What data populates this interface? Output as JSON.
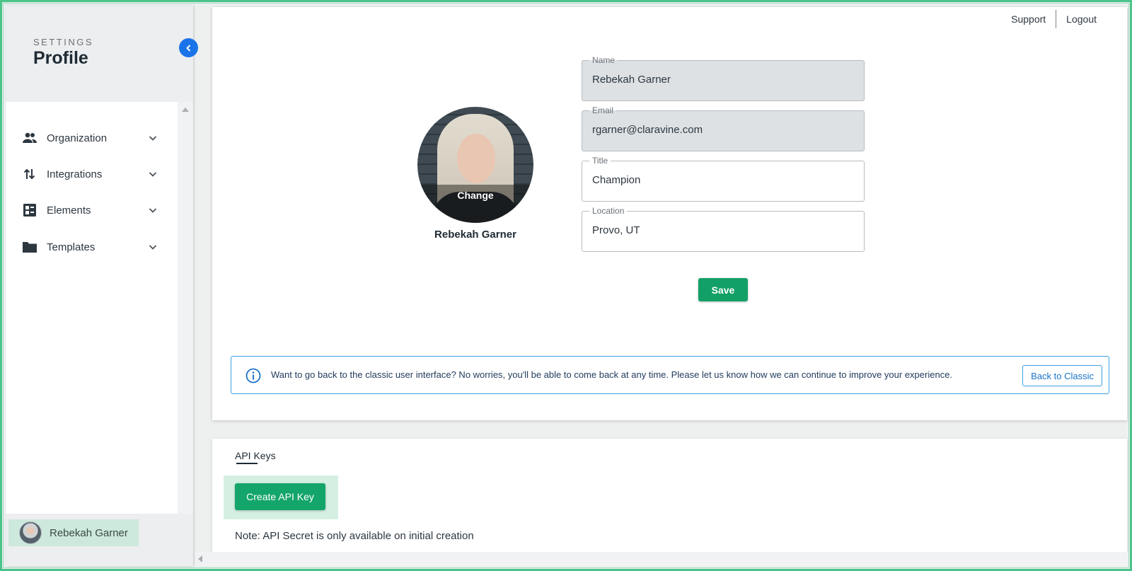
{
  "sidebar": {
    "section_label": "SETTINGS",
    "title": "Profile",
    "items": [
      {
        "label": "Organization",
        "icon": "people-icon"
      },
      {
        "label": "Integrations",
        "icon": "swap-vertical-icon"
      },
      {
        "label": "Elements",
        "icon": "dashboard-icon"
      },
      {
        "label": "Templates",
        "icon": "folder-icon"
      }
    ],
    "user_name": "Rebekah Garner"
  },
  "header": {
    "support_label": "Support",
    "logout_label": "Logout"
  },
  "profile": {
    "change_label": "Change",
    "display_name": "Rebekah Garner",
    "fields": {
      "name": {
        "label": "Name",
        "value": "Rebekah Garner"
      },
      "email": {
        "label": "Email",
        "value": "rgarner@claravine.com"
      },
      "title": {
        "label": "Title",
        "value": "Champion"
      },
      "location": {
        "label": "Location",
        "value": "Provo, UT"
      }
    },
    "save_label": "Save"
  },
  "notice": {
    "text": "Want to go back to the classic user interface? No worries, you'll be able to come back at any time. Please let us know how we can continue to improve your experience.",
    "button_label": "Back to Classic"
  },
  "api": {
    "tab_label": "API Keys",
    "create_label": "Create API Key",
    "note": "Note: API Secret is only available on initial creation"
  },
  "colors": {
    "accent_blue": "#1a73e8",
    "save_green": "#12a066",
    "frame_green": "#4cc38a"
  }
}
